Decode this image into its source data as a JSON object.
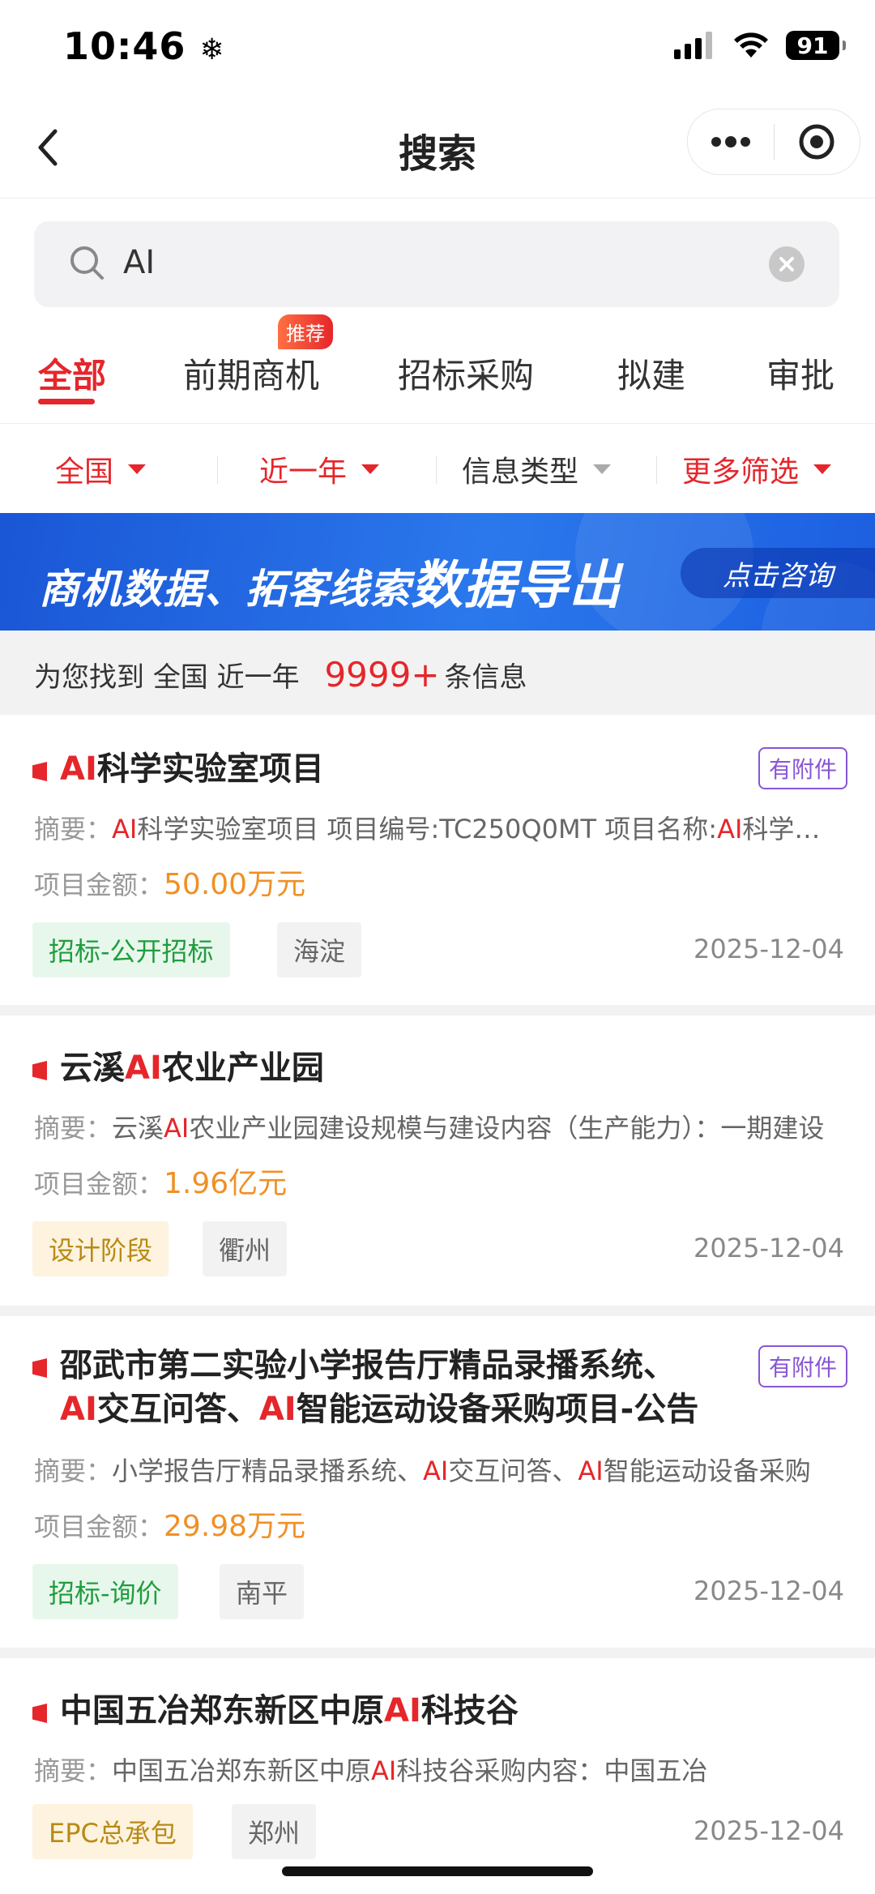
{
  "status_bar": {
    "time": "10:46",
    "battery": "91"
  },
  "nav": {
    "title": "搜索"
  },
  "search": {
    "value": "AI"
  },
  "tabs": [
    {
      "label": "全部"
    },
    {
      "label": "前期商机",
      "badge": "推荐"
    },
    {
      "label": "招标采购"
    },
    {
      "label": "拟建"
    },
    {
      "label": "审批"
    }
  ],
  "filters": [
    {
      "label": "全国"
    },
    {
      "label": "近一年"
    },
    {
      "label": "信息类型"
    },
    {
      "label": "更多筛选"
    }
  ],
  "banner": {
    "text_a": "商机数据、拓客线索",
    "text_b": "数据导出",
    "button": "点击咨询"
  },
  "summary": {
    "prefix": "为您找到",
    "region": "全国",
    "period": "近一年",
    "count": "9999+",
    "suffix": "条信息"
  },
  "labels": {
    "summary": "摘要：",
    "amount": "项目金额：",
    "attachment": "有附件"
  },
  "colors": {
    "brand_red": "#e5262b",
    "amount_orange": "#f09025",
    "attach_purple": "#8856d6",
    "banner_blue": "#2b78ec"
  },
  "results": [
    {
      "title": [
        [
          "AI",
          true
        ],
        [
          "科学实验室项目",
          false
        ]
      ],
      "has_attachment": true,
      "summary": [
        [
          "AI",
          true
        ],
        [
          "科学实验室项目 项目编号:TC250Q0MT 项目名称:",
          false
        ],
        [
          "AI",
          true
        ],
        [
          "科学实验室项目",
          false
        ]
      ],
      "amount": "50.00万元",
      "tags": [
        {
          "text": "招标-公开招标",
          "style": "green"
        },
        {
          "text": "海淀",
          "style": "gray"
        }
      ],
      "date": "2025-12-04"
    },
    {
      "title": [
        [
          "云溪",
          false
        ],
        [
          "AI",
          true
        ],
        [
          "农业产业园",
          false
        ]
      ],
      "has_attachment": false,
      "summary": [
        [
          "云溪",
          false
        ],
        [
          "AI",
          true
        ],
        [
          "农业产业园建设规模与建设内容（生产能力）：一期建设",
          false
        ]
      ],
      "amount": "1.96亿元",
      "tags": [
        {
          "text": "设计阶段",
          "style": "yellow"
        },
        {
          "text": "衢州",
          "style": "gray"
        }
      ],
      "date": "2025-12-04"
    },
    {
      "title": [
        [
          "邵武市第二实验小学报告厅精品录播系统、",
          false
        ],
        [
          "\n",
          false
        ],
        [
          "AI",
          true
        ],
        [
          "交互问答、",
          false
        ],
        [
          "AI",
          true
        ],
        [
          "智能运动设备采购项目-公告",
          false
        ]
      ],
      "has_attachment": true,
      "summary": [
        [
          "小学报告厅精品录播系统、",
          false
        ],
        [
          "AI",
          true
        ],
        [
          "交互问答、",
          false
        ],
        [
          "AI",
          true
        ],
        [
          "智能运动设备采购",
          false
        ]
      ],
      "amount": "29.98万元",
      "tags": [
        {
          "text": "招标-询价",
          "style": "green"
        },
        {
          "text": "南平",
          "style": "gray"
        }
      ],
      "date": "2025-12-04"
    },
    {
      "title": [
        [
          "中国五冶郑东新区中原",
          false
        ],
        [
          "AI",
          true
        ],
        [
          "科技谷",
          false
        ]
      ],
      "has_attachment": false,
      "summary": [
        [
          "中国五冶郑东新区中原",
          false
        ],
        [
          "AI",
          true
        ],
        [
          "科技谷采购内容：中国五冶",
          false
        ]
      ],
      "amount": null,
      "tags": [
        {
          "text": "EPC总承包",
          "style": "yellow"
        },
        {
          "text": "郑州",
          "style": "gray"
        }
      ],
      "date": "2025-12-04"
    }
  ]
}
